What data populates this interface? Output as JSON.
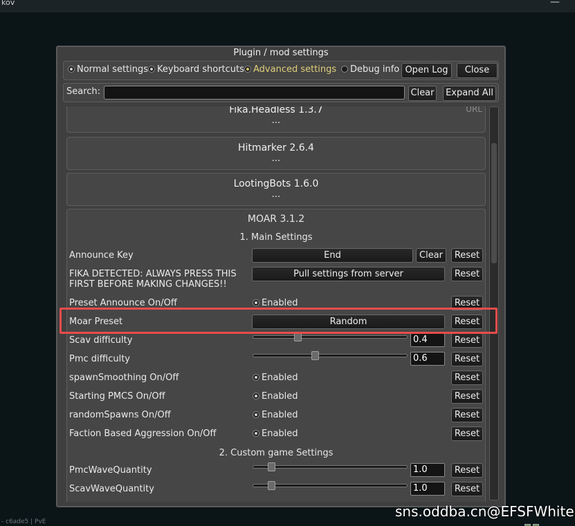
{
  "app": {
    "title": "kov",
    "close_glyph": "—"
  },
  "background": {
    "footer_text": "- c6ade5 | PvE",
    "watermark": "sns.oddba.cn@EFSFWhite"
  },
  "window": {
    "title": "Plugin / mod settings",
    "tabs": [
      {
        "label": "Normal settings",
        "selected": false
      },
      {
        "label": "Keyboard shortcuts",
        "selected": false
      },
      {
        "label": "Advanced settings",
        "selected": true
      }
    ],
    "debug_label": "Debug info",
    "open_log": "Open Log",
    "close": "Close",
    "search_label": "Search:",
    "search_value": "",
    "clear": "Clear",
    "expand_all": "Expand All",
    "url_label": "URL"
  },
  "mods": [
    {
      "name": "Fika.Headless 1.3.7",
      "collapsed": "..."
    },
    {
      "name": "Hitmarker 2.6.4",
      "collapsed": "..."
    },
    {
      "name": "LootingBots 1.6.0",
      "collapsed": "..."
    }
  ],
  "moar": {
    "title": "MOAR 3.1.2",
    "section_main": "1. Main Settings",
    "section_custom": "2. Custom game Settings",
    "reset": "Reset",
    "clear": "Clear",
    "enabled": "Enabled",
    "announce_key": {
      "label": "Announce Key",
      "value": "End"
    },
    "fika": {
      "label": "FIKA DETECTED: ALWAYS PRESS THIS FIRST BEFORE MAKING CHANGES!!",
      "button": "Pull settings from server"
    },
    "preset_announce": {
      "label": "Preset Announce On/Off"
    },
    "moar_preset": {
      "label": "Moar Preset",
      "value": "Random"
    },
    "scav_difficulty": {
      "label": "Scav difficulty",
      "value": "0.4",
      "level": 0.28
    },
    "pmc_difficulty": {
      "label": "Pmc difficulty",
      "value": "0.6",
      "level": 0.4
    },
    "toggles": [
      {
        "label": "spawnSmoothing On/Off"
      },
      {
        "label": "Starting PMCS On/Off"
      },
      {
        "label": "randomSpawns On/Off"
      },
      {
        "label": "Faction Based Aggression On/Off"
      }
    ],
    "pmc_wave": {
      "label": "PmcWaveQuantity",
      "value": "1.0",
      "level": 0.1
    },
    "scav_wave": {
      "label": "ScavWaveQuantity",
      "value": "1.0",
      "level": 0.1
    }
  },
  "colors": {
    "highlight": "#e84c4c",
    "accent_tab": "#e0cf7a"
  }
}
